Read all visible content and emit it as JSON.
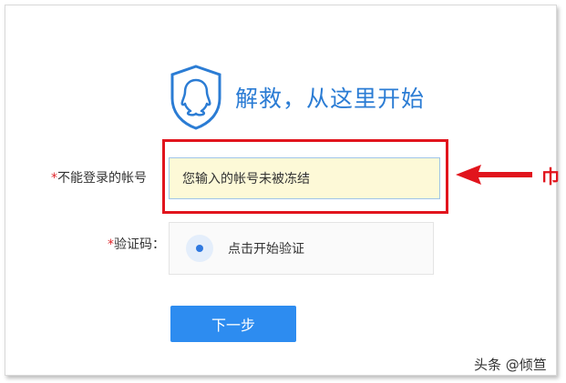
{
  "header": {
    "title": "解救，从这里开始",
    "logo_icon": "qq-penguin-shield-icon"
  },
  "form": {
    "account": {
      "required_mark": "*",
      "label": "不能登录的帐号",
      "value": "您输入的帐号未被冻结"
    },
    "captcha": {
      "required_mark": "*",
      "label": "验证码：",
      "button_text": "点击开始验证"
    },
    "next_button": "下一步"
  },
  "annotation": {
    "arrow_icon": "red-arrow-left-icon",
    "edge_glyph": "巾"
  },
  "watermark": "头条 @倾笪",
  "colors": {
    "accent": "#2b7cd4",
    "button": "#2d8cf0",
    "highlight": "#e1141d",
    "input_bg": "#fdf9d7"
  }
}
